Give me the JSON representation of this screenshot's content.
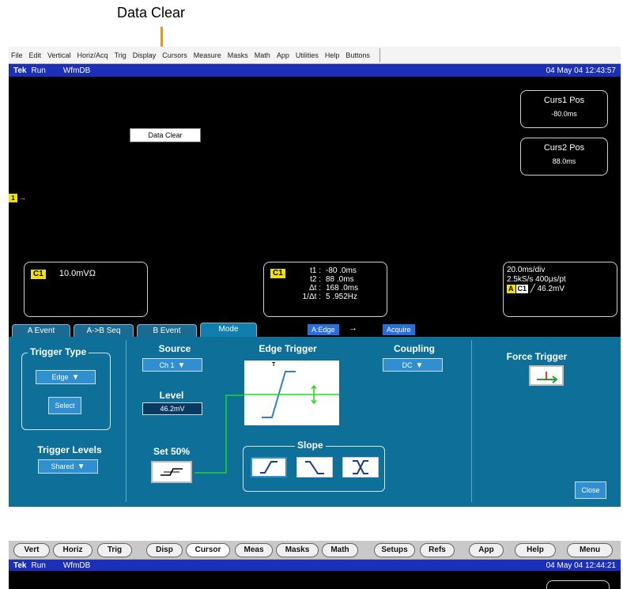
{
  "annotation": {
    "label": "Data Clear"
  },
  "screen1": {
    "menu": [
      "File",
      "Edit",
      "Vertical",
      "Horiz/Acq",
      "Trig",
      "Display",
      "Cursors",
      "Measure",
      "Masks",
      "Math",
      "App",
      "Utilities",
      "Help",
      "Buttons"
    ],
    "status": {
      "brand": "Tek",
      "state": "Run",
      "mode": "WfmDB",
      "timestamp": "04 May 04 12:43:57"
    },
    "curs1": {
      "title": "Curs1 Pos",
      "value": "-80.0ms"
    },
    "curs2": {
      "title": "Curs2 Pos",
      "value": "88.0ms"
    },
    "popup": "Data Clear",
    "channel_marker": "1",
    "channel_box": {
      "chip": "C1",
      "scale": "10.0mVΩ"
    },
    "cursor_readout": {
      "chip": "C1",
      "rows": [
        {
          "label": "t1 :",
          "value": "-80 .0ms"
        },
        {
          "label": "t2 :",
          "value": "88 .0ms"
        },
        {
          "label": "Δt :",
          "value": "168 .0ms"
        },
        {
          "label": "1/Δt :",
          "value": "5 .952Hz"
        }
      ]
    },
    "horizontal": {
      "line1": "20.0ms/div",
      "line2": "2.5kS/s   400μs/pt",
      "trig_chip_a": "A",
      "trig_chip_c": "C1",
      "trig_value": "╱ 46.2mV"
    },
    "tabs": [
      "A Event",
      "A->B Seq",
      "B Event",
      "Mode"
    ],
    "tab_status": {
      "edge": "A:Edge",
      "arrow": "→",
      "acquire": "Acquire"
    },
    "panel": {
      "trigger_type": {
        "title": "Trigger Type",
        "value": "Edge",
        "select": "Select"
      },
      "trigger_levels": {
        "title": "Trigger Levels",
        "value": "Shared"
      },
      "source": {
        "title": "Source",
        "value": "Ch 1"
      },
      "level": {
        "title": "Level",
        "value": "46.2mV"
      },
      "set50": {
        "title": "Set 50%"
      },
      "edge_trigger": {
        "title": "Edge Trigger",
        "marker": "T"
      },
      "slope": {
        "title": "Slope"
      },
      "coupling": {
        "title": "Coupling",
        "value": "DC"
      },
      "force": {
        "title": "Force Trigger",
        "icon": "T"
      },
      "close": "Close"
    }
  },
  "screen2": {
    "buttons": [
      "Vert",
      "Horiz",
      "Trig",
      "Disp",
      "Cursor",
      "Meas",
      "Masks",
      "Math",
      "Setups",
      "Refs",
      "App",
      "Help",
      "Menu"
    ],
    "selected": "Cursor",
    "status": {
      "brand": "Tek",
      "state": "Run",
      "mode": "WfmDB",
      "timestamp": "04 May 04 12:44:21"
    }
  },
  "colors": {
    "status_bar": "#1c2fb8",
    "panel": "#0e6f99",
    "callout": "#e8960e",
    "trace": "#22d722",
    "chip": "#f2e100"
  }
}
